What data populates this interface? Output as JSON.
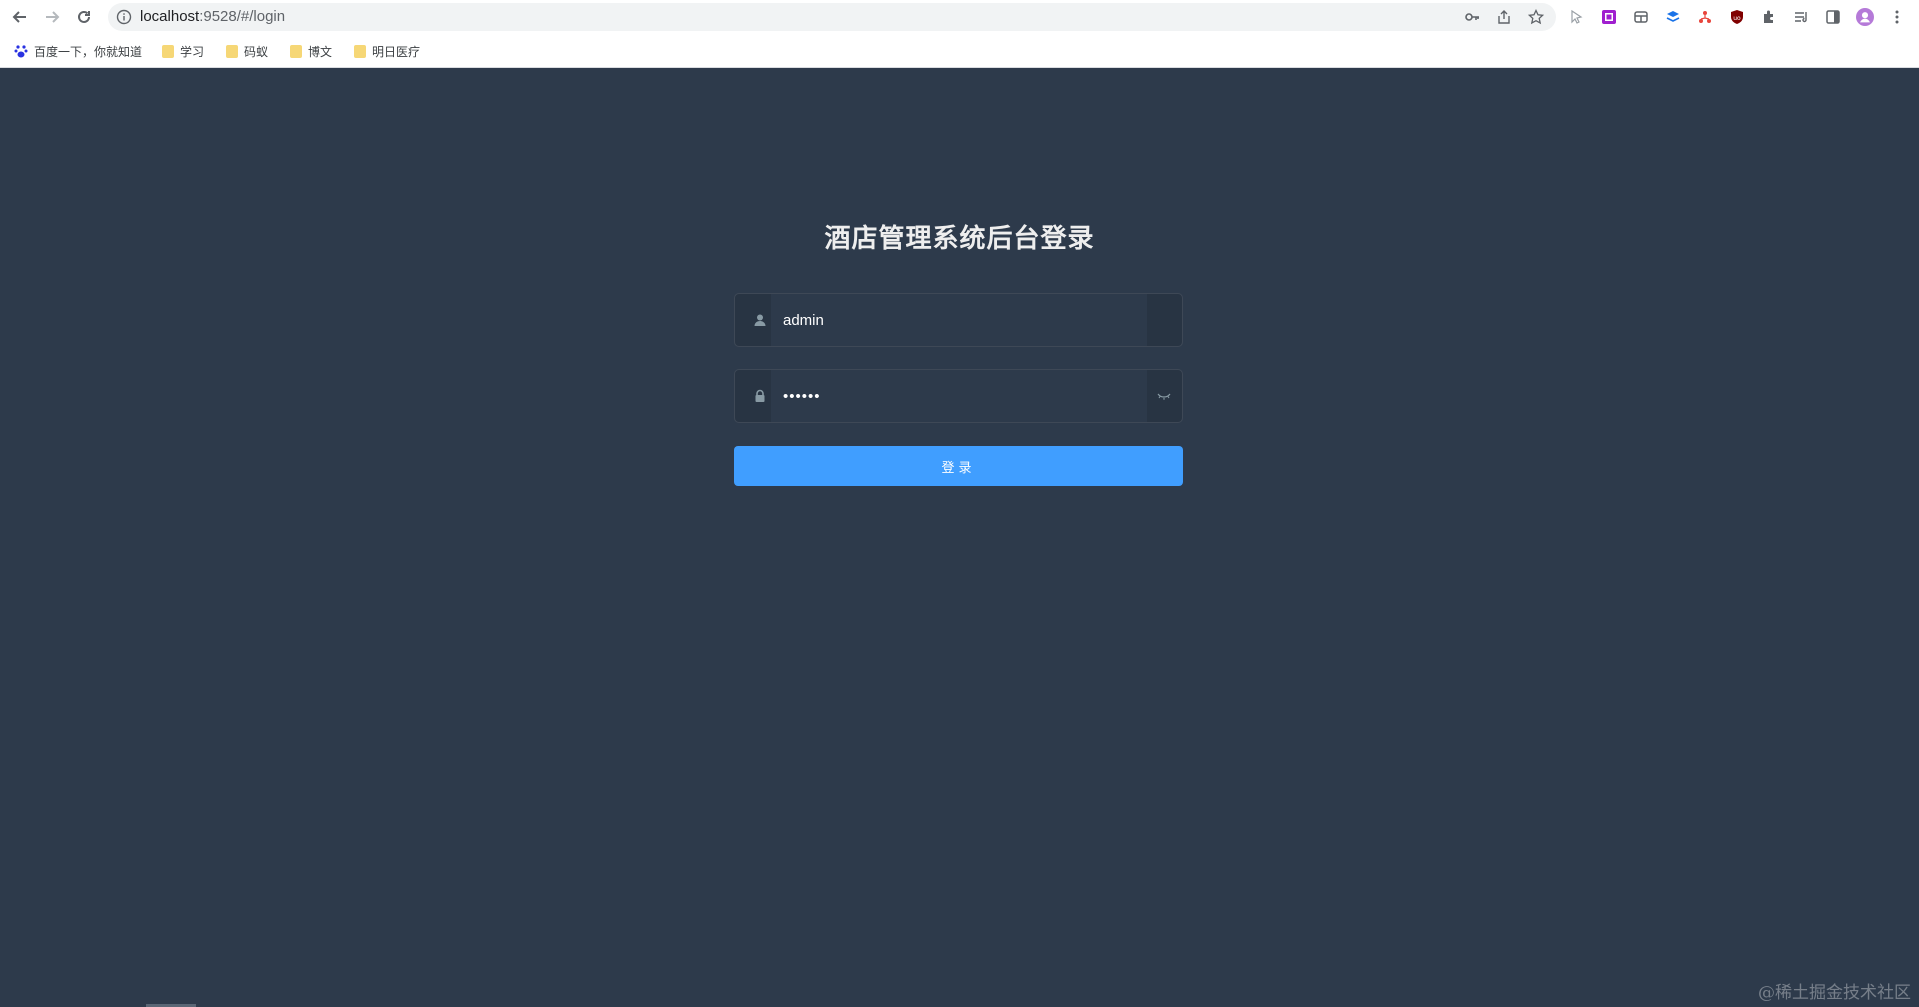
{
  "browser": {
    "url_host": "localhost",
    "url_path": ":9528/#/login",
    "bookmarks": [
      {
        "label": "百度一下，你就知道",
        "icon": "baidu-icon"
      },
      {
        "label": "学习",
        "icon": "folder-icon"
      },
      {
        "label": "码蚁",
        "icon": "folder-icon"
      },
      {
        "label": "博文",
        "icon": "folder-icon"
      },
      {
        "label": "明日医疗",
        "icon": "folder-icon"
      }
    ]
  },
  "login": {
    "title": "酒店管理系统后台登录",
    "username_value": "admin",
    "password_value": "••••••",
    "submit_label": "登录"
  },
  "watermark": "@稀土掘金技术社区",
  "colors": {
    "page_bg": "#2d3a4b",
    "primary": "#409eff",
    "title": "#eeeeee"
  }
}
